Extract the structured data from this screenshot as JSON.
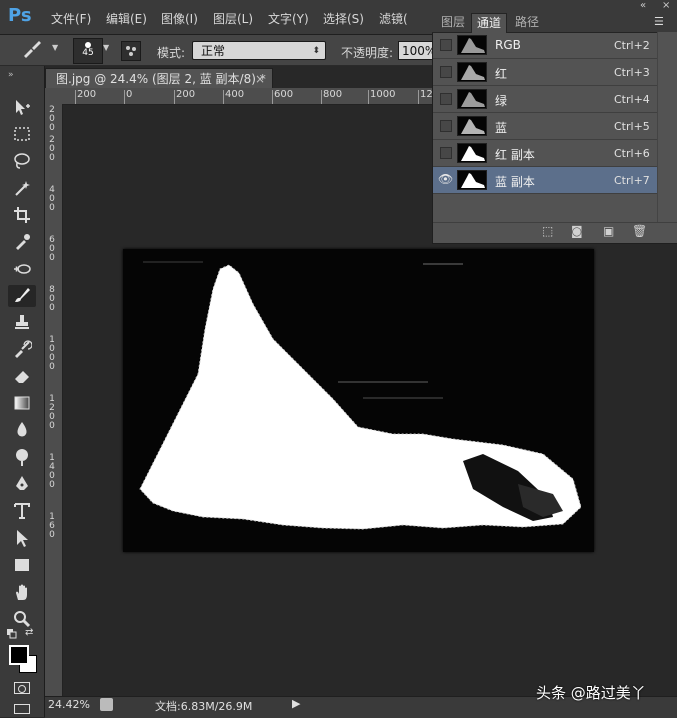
{
  "app": {
    "logo": "Ps"
  },
  "menu": [
    "文件(F)",
    "编辑(E)",
    "图像(I)",
    "图层(L)",
    "文字(Y)",
    "选择(S)",
    "滤镜("
  ],
  "options": {
    "brush_size": "45",
    "mode_label": "模式:",
    "mode_value": "正常",
    "opacity_label": "不透明度:",
    "opacity_value": "100%"
  },
  "document": {
    "tab_title": "图.jpg @ 24.4% (图层 2, 蓝 副本/8) *",
    "tab_close": "×",
    "ruler_h": [
      "200",
      "0",
      "200",
      "400",
      "600",
      "800",
      "1000",
      "12"
    ],
    "ruler_v": [
      "2",
      "0",
      "0",
      "2",
      "0",
      "0",
      "4",
      "0",
      "0",
      "6",
      "0",
      "0",
      "8",
      "0",
      "0",
      "1",
      "0",
      "0",
      "0",
      "1",
      "2",
      "0",
      "0",
      "1",
      "4",
      "0",
      "0",
      "1",
      "6",
      "0"
    ]
  },
  "status": {
    "zoom": "24.42%",
    "doc_info": "文档:6.83M/26.9M"
  },
  "watermark": "头条 @路过美丫",
  "panel": {
    "tabs": [
      "图层",
      "通道",
      "路径"
    ],
    "active_tab": "通道",
    "channels": [
      {
        "name": "RGB",
        "shortcut": "Ctrl+2",
        "visible": false,
        "selected": false
      },
      {
        "name": "红",
        "shortcut": "Ctrl+3",
        "visible": false,
        "selected": false
      },
      {
        "name": "绿",
        "shortcut": "Ctrl+4",
        "visible": false,
        "selected": false
      },
      {
        "name": "蓝",
        "shortcut": "Ctrl+5",
        "visible": false,
        "selected": false
      },
      {
        "name": "红 副本",
        "shortcut": "Ctrl+6",
        "visible": false,
        "selected": false
      },
      {
        "name": "蓝 副本",
        "shortcut": "Ctrl+7",
        "visible": true,
        "selected": true
      }
    ]
  },
  "colors": {
    "selection_highlight": "#5c6f8b",
    "ps_logo": "#4fa3e6",
    "canvas_bg": "#282828"
  }
}
